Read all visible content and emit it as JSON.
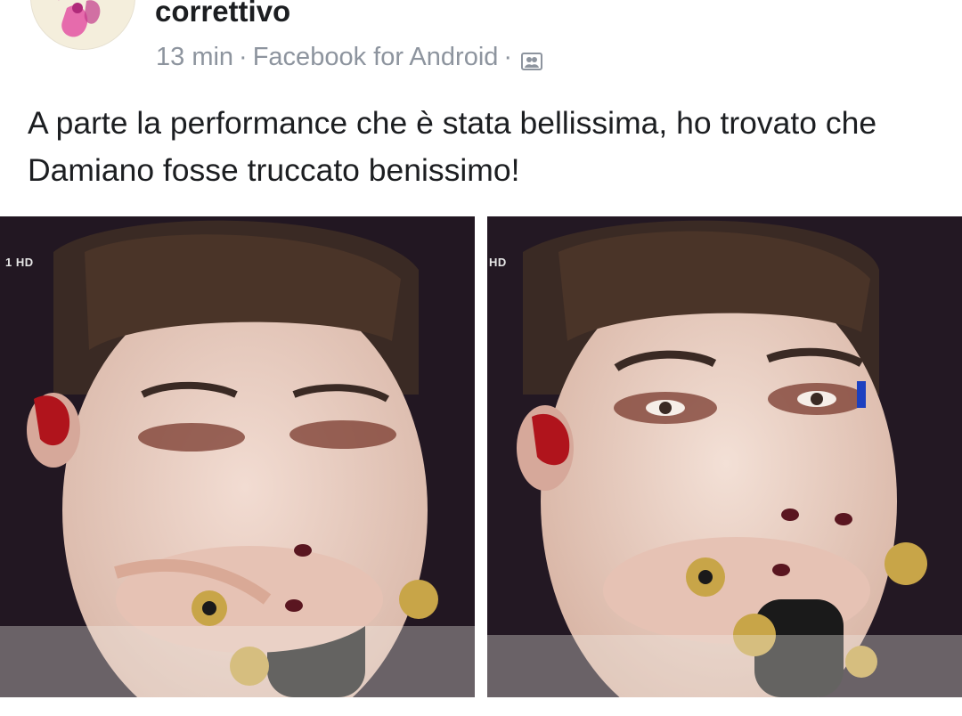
{
  "post": {
    "author": "correttivo",
    "time": "13 min",
    "source": "Facebook for Android",
    "separator": "·",
    "audience_icon": "friends-icon",
    "text": "A parte la performance che è stata bellissima, ho trovato che Damiano fosse truccato benissimo!"
  },
  "photos": [
    {
      "channel_badge": "1 HD",
      "description_icon": "photo"
    },
    {
      "channel_badge": "HD",
      "description_icon": "photo"
    }
  ],
  "colors": {
    "text": "#1c1e21",
    "meta": "#8d949e",
    "photo_background": "#1c1420"
  }
}
